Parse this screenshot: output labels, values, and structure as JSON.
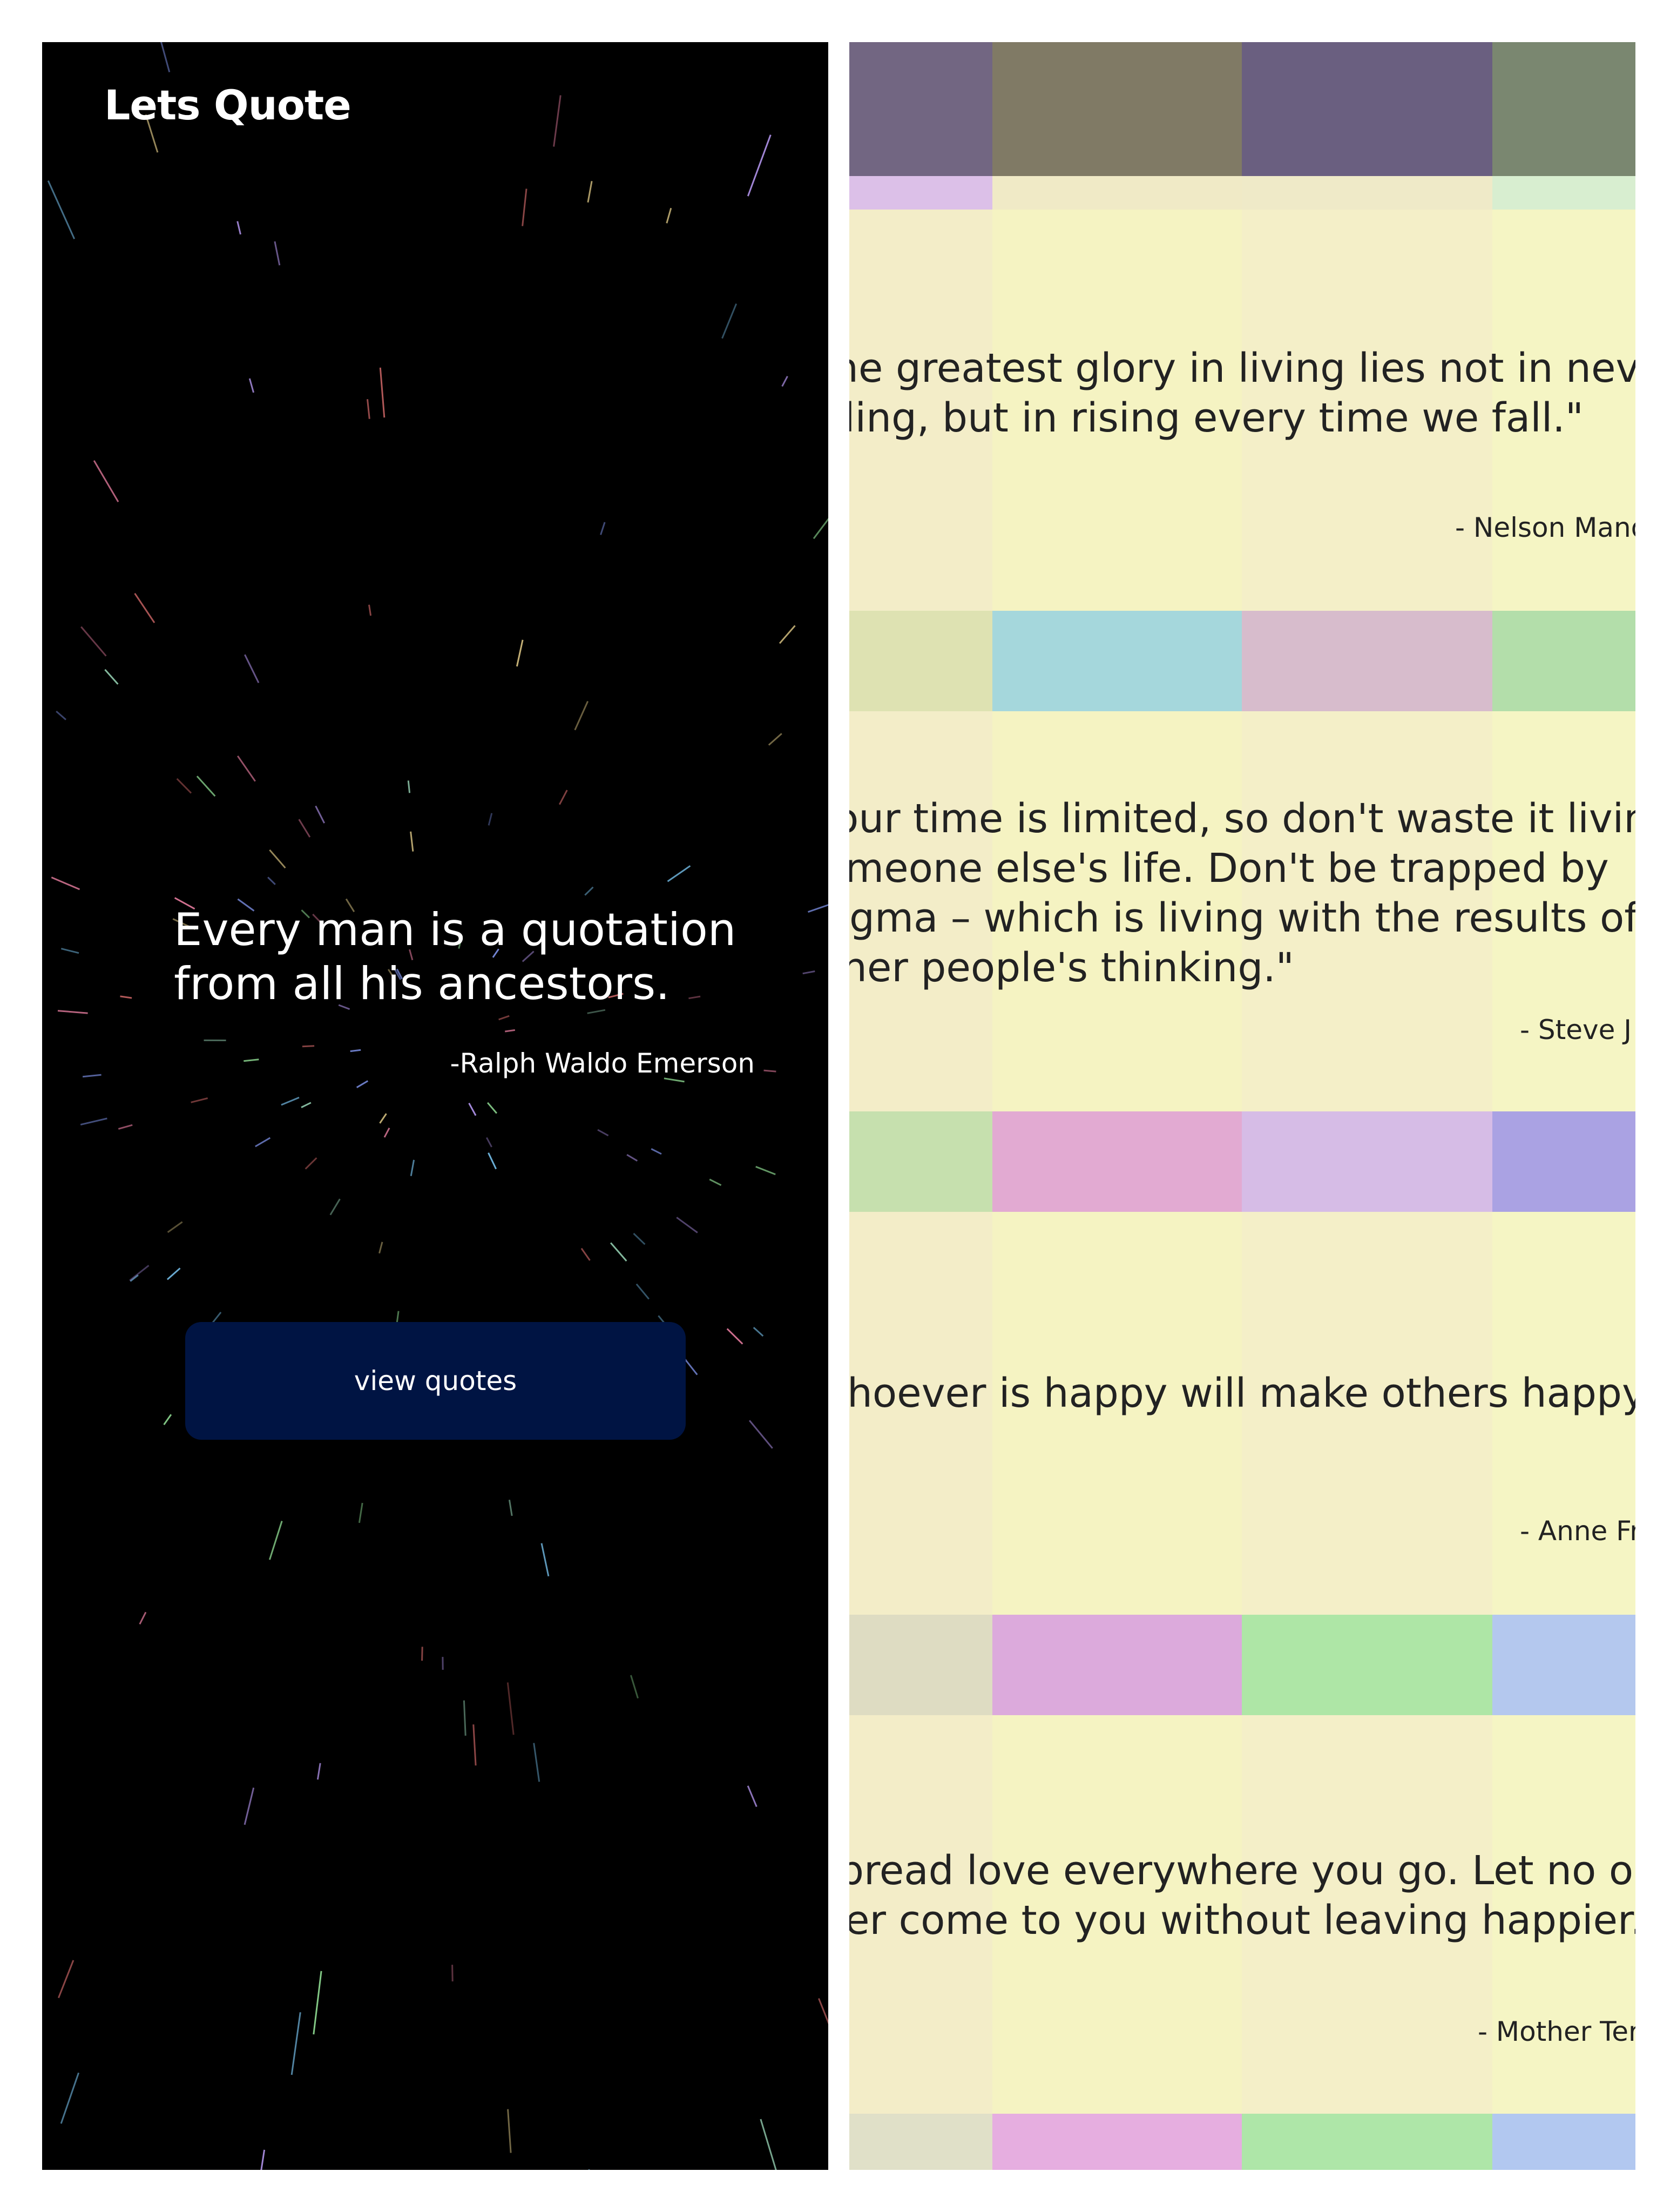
{
  "app": {
    "title": "Lets Quote",
    "featured_quote": "Every man is a quotation from all his ancestors.",
    "featured_author": "-Ralph Waldo Emerson",
    "button_label": "view quotes",
    "button_color": "#001443"
  },
  "quotes": [
    {
      "text_line1": "he greatest glory in living lies not in never",
      "text_line2": "ling, but in rising every time we fall.\"",
      "author": "- Nelson Mand"
    },
    {
      "text_line1": "our time is limited, so don't waste it living",
      "text_line2": "meone else's life. Don't be trapped by",
      "text_line3": "gma – which is living with the results of",
      "text_line4": "her people's thinking.\"",
      "author": "- Steve J"
    },
    {
      "text_line1": "hoever is happy will make others happy to",
      "author": "- Anne Fr"
    },
    {
      "text_line1": "pread love everywhere you go. Let no one",
      "text_line2": "er come to you without leaving happier.\"",
      "author": "- Mother Ter"
    }
  ],
  "colors": {
    "card_background": "#f5f2c4",
    "top_band": [
      "#726682",
      "#807a65",
      "#6a5f80",
      "#7a8770"
    ],
    "row1": [
      "#dee2b2",
      "#a5d7dc",
      "#d7bccc",
      "#b3deaa"
    ],
    "row2": [
      "#c6e0ae",
      "#e2aad2",
      "#d6bce6",
      "#aaa2e3"
    ],
    "row3": [
      "#dedcc2",
      "#dcaadc",
      "#aee6a6",
      "#b4c8ee"
    ],
    "row4": [
      "#e0e0c8",
      "#e6aee0",
      "#aee6a8",
      "#b2c8f0"
    ]
  }
}
